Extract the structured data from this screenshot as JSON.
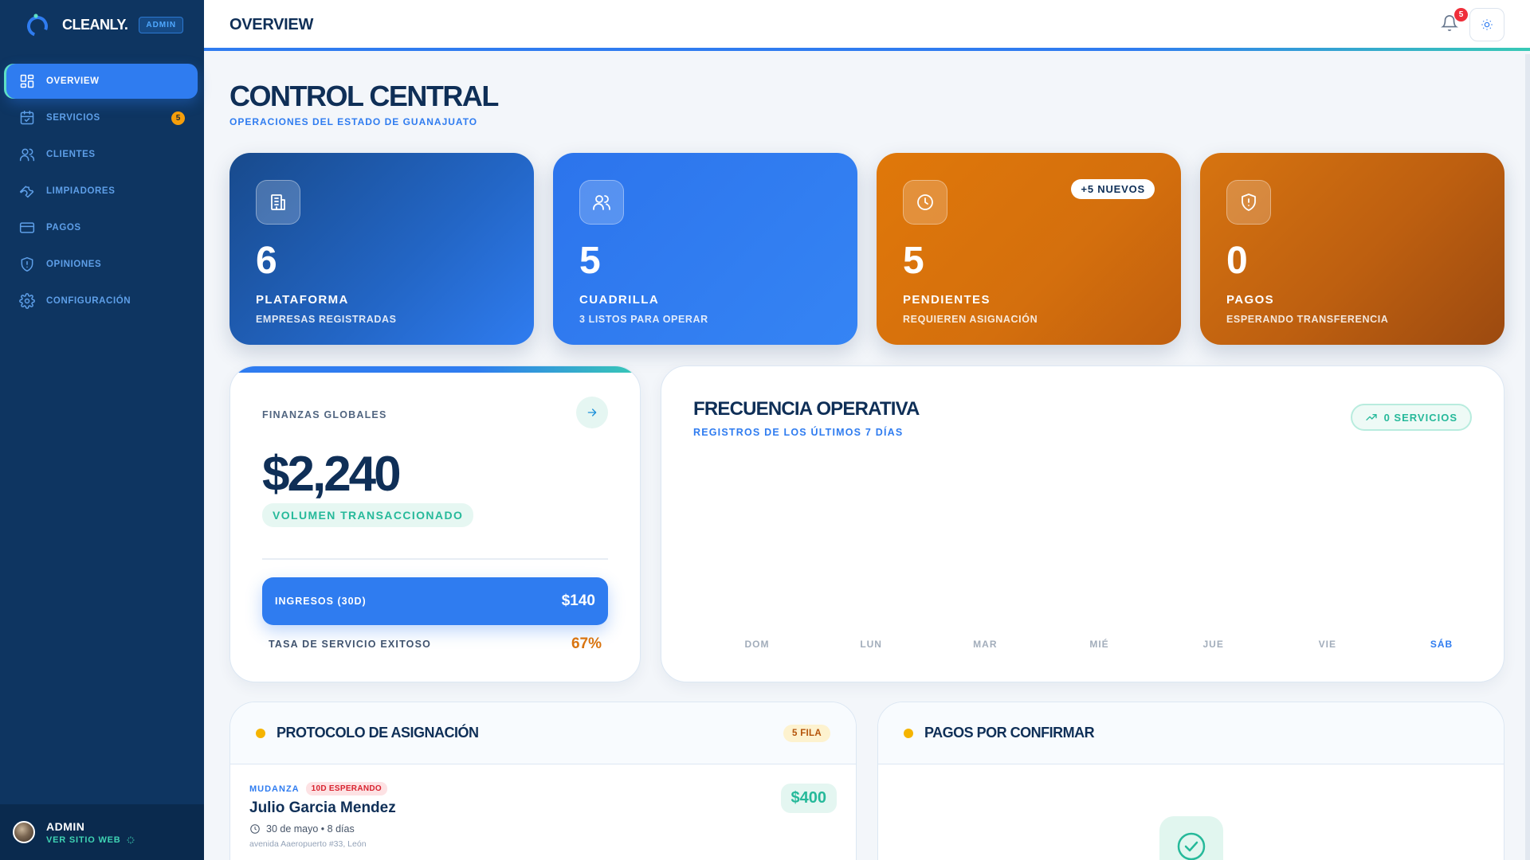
{
  "brand": {
    "name": "CLEANLY.",
    "badge": "ADMIN"
  },
  "sidebar": {
    "items": [
      {
        "label": "OVERVIEW",
        "icon": "grid-icon",
        "active": true
      },
      {
        "label": "SERVICIOS",
        "icon": "calendar-icon",
        "count": "5"
      },
      {
        "label": "CLIENTES",
        "icon": "users-icon"
      },
      {
        "label": "LIMPIADORES",
        "icon": "wrench-icon"
      },
      {
        "label": "PAGOS",
        "icon": "card-icon"
      },
      {
        "label": "OPINIONES",
        "icon": "shield-icon"
      },
      {
        "label": "CONFIGURACIÓN",
        "icon": "gear-icon"
      }
    ],
    "user": {
      "name": "ADMIN",
      "link": "VER SITIO WEB"
    }
  },
  "header": {
    "title": "OVERVIEW",
    "notifications": "5"
  },
  "page": {
    "title": "CONTROL CENTRAL",
    "subtitle": "OPERACIONES DEL ESTADO DE GUANAJUATO"
  },
  "stats": [
    {
      "value": "6",
      "label": "PLATAFORMA",
      "sub": "EMPRESAS REGISTRADAS",
      "icon": "building-icon",
      "color": "#1d5aa8"
    },
    {
      "value": "5",
      "label": "CUADRILLA",
      "sub": "3 LISTOS PARA OPERAR",
      "icon": "users-icon",
      "color": "#2f7cf0"
    },
    {
      "value": "5",
      "label": "PENDIENTES",
      "sub": "REQUIEREN ASIGNACIÓN",
      "icon": "clock-icon",
      "tag": "+5 NUEVOS",
      "color": "#d9740f"
    },
    {
      "value": "0",
      "label": "PAGOS",
      "sub": "ESPERANDO TRANSFERENCIA",
      "icon": "shield-alert-icon",
      "color": "#c9660c"
    }
  ],
  "finance": {
    "heading": "FINANZAS GLOBALES",
    "total": "$2,240",
    "total_label": "VOLUMEN TRANSACCIONADO",
    "income_label": "INGRESOS (30D)",
    "income_value": "$140",
    "rate_label": "TASA DE SERVICIO EXITOSO",
    "rate_value": "67%"
  },
  "activity": {
    "title": "FRECUENCIA OPERATIVA",
    "subtitle": "REGISTROS DE LOS ÚLTIMOS 7 DÍAS",
    "pill": "0 SERVICIOS"
  },
  "chart_data": {
    "type": "area",
    "x": [
      "DOM",
      "LUN",
      "MAR",
      "MIÉ",
      "JUE",
      "VIE",
      "SÁB"
    ],
    "values": [
      0,
      0,
      0,
      0,
      0,
      0,
      0
    ],
    "highlight": "SÁB",
    "title": "FRECUENCIA OPERATIVA",
    "grid": false
  },
  "assignment": {
    "title": "PROTOCOLO DE ASIGNACIÓN",
    "badge": "5 FILA",
    "item": {
      "type": "MUDANZA",
      "wait": "10D ESPERANDO",
      "name": "Julio Garcia Mendez",
      "date": "30 de mayo • 8 días",
      "address": "avenida Aaeropuerto #33, León",
      "price": "$400"
    }
  },
  "payments": {
    "title": "PAGOS POR CONFIRMAR"
  }
}
